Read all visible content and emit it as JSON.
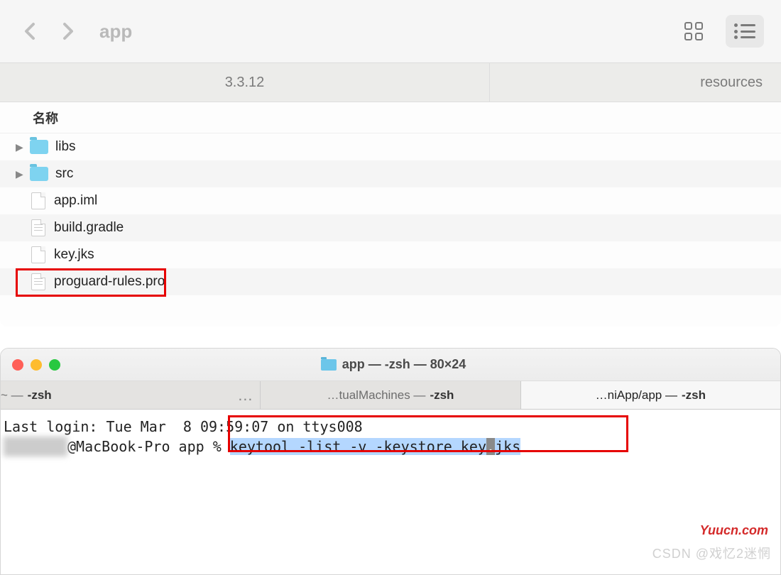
{
  "finder": {
    "title": "app",
    "path_left": "3.3.12",
    "path_right": "resources",
    "column_header": "名称",
    "items": [
      {
        "name": "libs",
        "type": "folder",
        "expandable": true
      },
      {
        "name": "src",
        "type": "folder",
        "expandable": true
      },
      {
        "name": "app.iml",
        "type": "file",
        "expandable": false
      },
      {
        "name": "build.gradle",
        "type": "textfile",
        "expandable": false
      },
      {
        "name": "key.jks",
        "type": "file",
        "expandable": false
      },
      {
        "name": "proguard-rules.pro",
        "type": "textfile",
        "expandable": false
      }
    ]
  },
  "terminal": {
    "title": "app — -zsh — 80×24",
    "tabs": [
      {
        "label_prefix": "~ — ",
        "label_strong": "-zsh",
        "active": false,
        "show_ellipsis": true
      },
      {
        "label_prefix": "…tualMachines — ",
        "label_strong": "-zsh",
        "active": false,
        "show_ellipsis": false
      },
      {
        "label_prefix": "…niApp/app — ",
        "label_strong": "-zsh",
        "active": true,
        "show_ellipsis": false
      }
    ],
    "last_login": "Last login: Tue Mar  8 09:59:07 on ttys008",
    "prompt_host": "@MacBook-Pro app % ",
    "command_pre": "keytool -list -v -keystore key",
    "command_cursor": ".",
    "command_post": "jks"
  },
  "watermarks": {
    "w1": "Yuucn.com",
    "w2": "CSDN @戏忆2迷惘"
  }
}
